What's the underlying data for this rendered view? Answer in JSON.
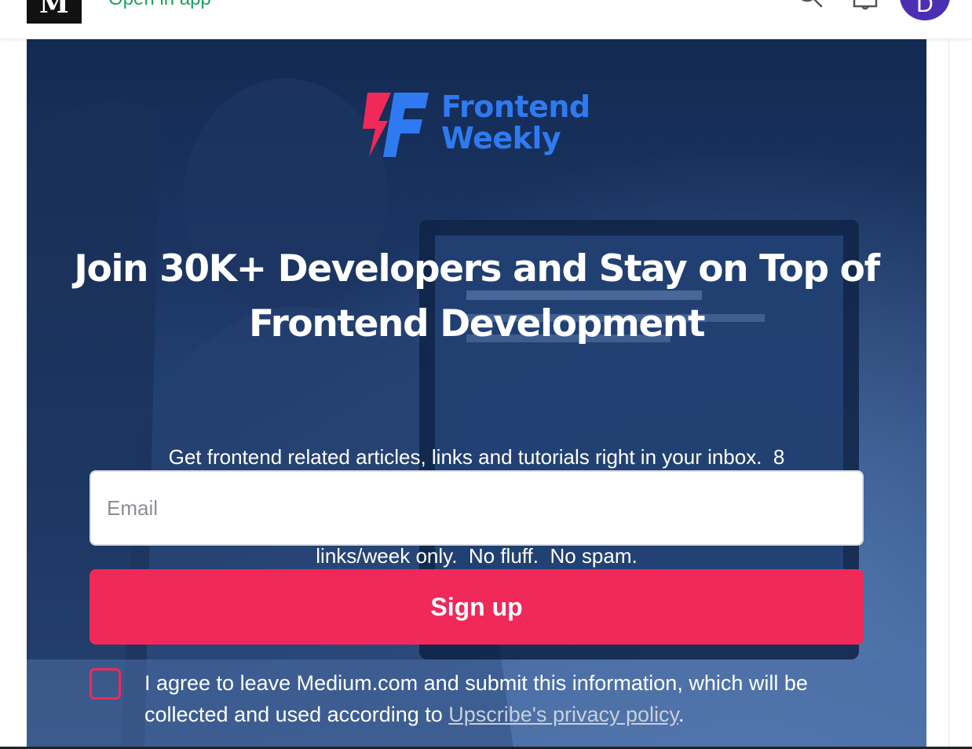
{
  "nav": {
    "logo_text": "M",
    "open_in_app": "Open in app",
    "avatar_initial": "D",
    "colors": {
      "open_in_app": "#1aa260",
      "avatar": "#4b2fb3"
    }
  },
  "promo": {
    "brand_line1": "Frontend",
    "brand_line2": "Weekly",
    "headline_line1": "Join 30K+ Developers and Stay on Top of",
    "headline_line2": "Frontend Development",
    "subtext_line1": "Get frontend related articles, links and tutorials right in your inbox.  8",
    "subtext_line2": "links/week only.  No fluff.  No spam.",
    "email_placeholder": "Email",
    "email_value": "",
    "signup_label": "Sign up",
    "consent_text": "I agree to leave Medium.com and submit this information, which will be collected and used according to ",
    "consent_link": "Upscribe's privacy policy",
    "consent_end": ".",
    "consent_checked": false,
    "colors": {
      "accent": "#f0295a",
      "brand_blue": "#2f7af0",
      "overlay": "#1f3a6b"
    }
  }
}
